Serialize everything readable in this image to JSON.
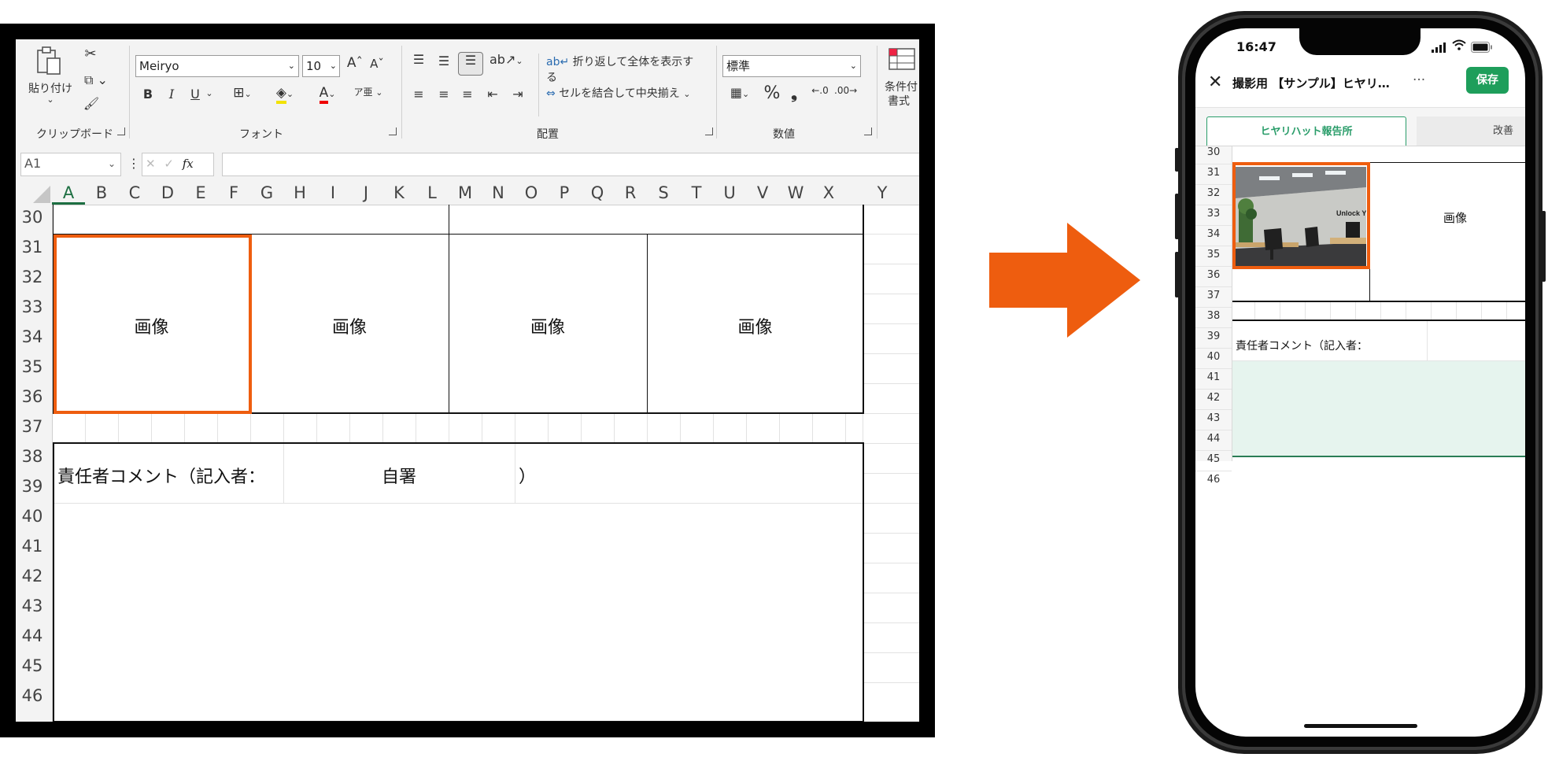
{
  "excel": {
    "ribbon": {
      "paste_label": "貼り付け",
      "font_name": "Meiryo",
      "font_size": "10",
      "wrap_label": "折り返して全体を表示する",
      "merge_label": "セルを結合して中央揃え",
      "number_format": "標準",
      "conditional_label_1": "条件付",
      "conditional_label_2": "書式",
      "groups": {
        "clipboard": "クリップボード",
        "font": "フォント",
        "alignment": "配置",
        "number": "数値"
      },
      "bold": "B",
      "italic": "I",
      "underline": "U",
      "percent": "%",
      "comma": "❟"
    },
    "name_box": "A1",
    "fx_label": "fx",
    "columns": [
      "A",
      "B",
      "C",
      "D",
      "E",
      "F",
      "G",
      "H",
      "I",
      "J",
      "K",
      "L",
      "M",
      "N",
      "O",
      "P",
      "Q",
      "R",
      "S",
      "T",
      "U",
      "V",
      "W",
      "X",
      "Y"
    ],
    "rows": [
      "30",
      "31",
      "32",
      "33",
      "34",
      "35",
      "36",
      "37",
      "38",
      "39",
      "40",
      "41",
      "42",
      "43",
      "44",
      "45",
      "46"
    ],
    "image_cells": [
      "画像",
      "画像",
      "画像",
      "画像"
    ],
    "comment_label": "責任者コメント（記入者：",
    "signature_value": "自署",
    "close_paren": "）"
  },
  "phone": {
    "time": "16:47",
    "back_label": "✕",
    "doc_title": "撮影用 【サンプル】ヒヤリ…",
    "more_label": "···",
    "save_label": "保存",
    "tabs": [
      "ヒヤリハット報告所",
      "改善"
    ],
    "rows": [
      "30",
      "31",
      "32",
      "33",
      "34",
      "35",
      "36",
      "37",
      "38",
      "39",
      "40",
      "41",
      "42",
      "43",
      "44",
      "45",
      "46"
    ],
    "photo_caption": "Unlock Y",
    "image_cell": "画像",
    "comment_label": "責任者コメント（記入者："
  },
  "colors": {
    "highlight": "#ee5d0f",
    "save_green": "#1e9e5b",
    "tab_green": "#2a9d6a",
    "comment_fill": "#e6f4ee"
  }
}
